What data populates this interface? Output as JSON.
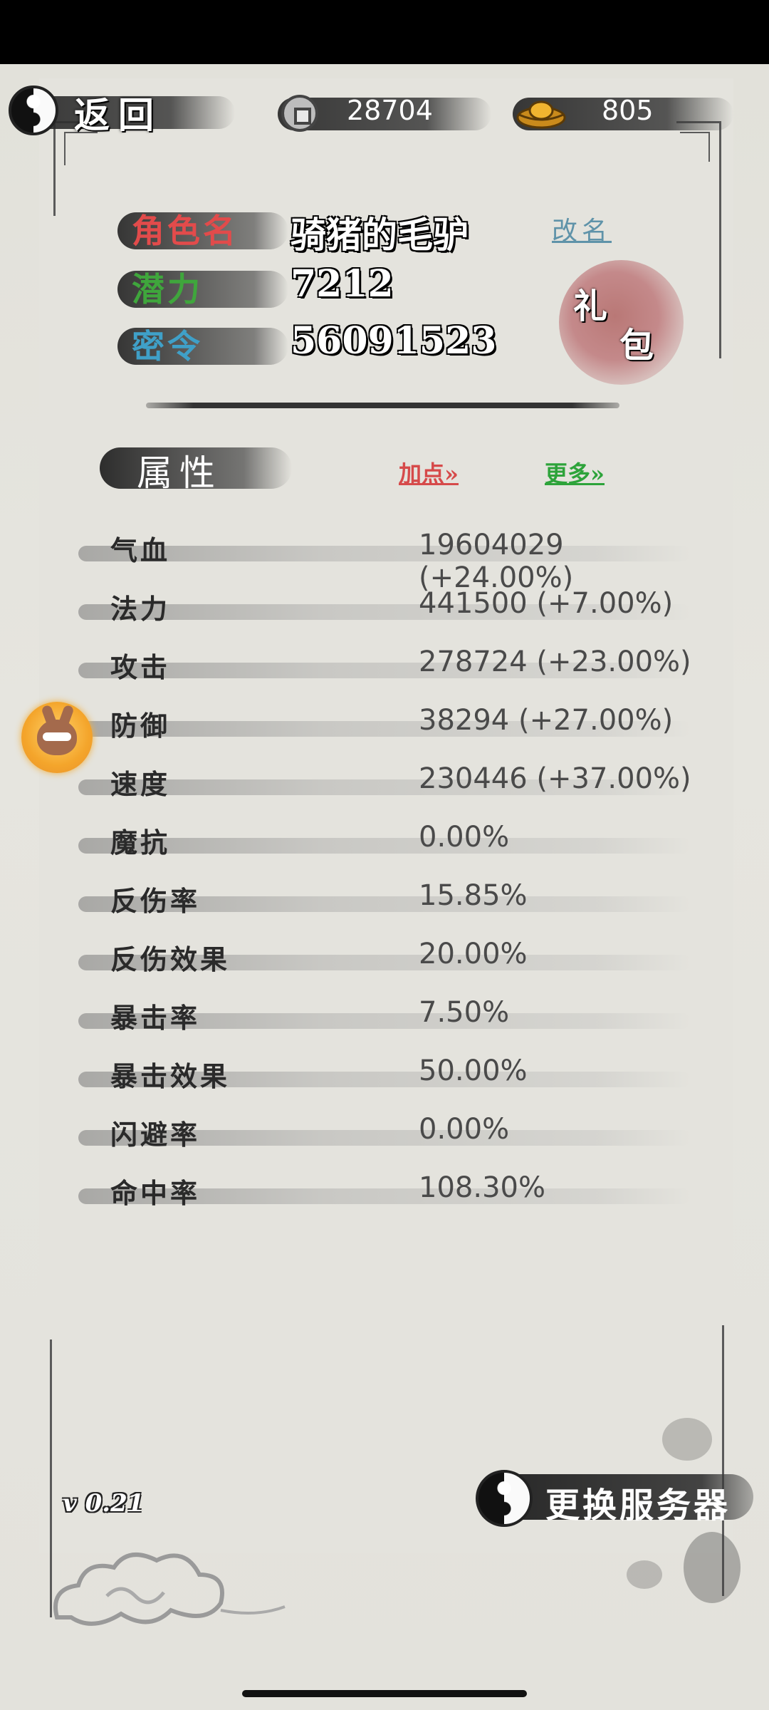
{
  "header": {
    "back_label": "返回",
    "coins": "28704",
    "gold": "805"
  },
  "profile": {
    "name_label": "角色名",
    "name_value": "骑猪的毛驴",
    "rename_label": "改名",
    "potential_label": "潜力",
    "potential_value": "7212",
    "password_label": "密令",
    "password_value": "56091523",
    "gift_label_1": "礼",
    "gift_label_2": "包"
  },
  "attributes": {
    "title": "属性",
    "add_points_label": "加点»",
    "more_label": "更多»",
    "rows": [
      {
        "name": "气血",
        "value": "19604029 (+24.00%)"
      },
      {
        "name": "法力",
        "value": "441500 (+7.00%)"
      },
      {
        "name": "攻击",
        "value": "278724 (+23.00%)"
      },
      {
        "name": "防御",
        "value": "38294 (+27.00%)"
      },
      {
        "name": "速度",
        "value": "230446 (+37.00%)"
      },
      {
        "name": "魔抗",
        "value": "0.00%"
      },
      {
        "name": "反伤率",
        "value": "15.85%"
      },
      {
        "name": "反伤效果",
        "value": "20.00%"
      },
      {
        "name": "暴击率",
        "value": "7.50%"
      },
      {
        "name": "暴击效果",
        "value": "50.00%"
      },
      {
        "name": "闪避率",
        "value": "0.00%"
      },
      {
        "name": "命中率",
        "value": "108.30%"
      }
    ]
  },
  "footer": {
    "version": "v 0.21",
    "change_server_label": "更换服务器"
  },
  "colors": {
    "name_label": "#e24b4b",
    "potential_label": "#3fa63c",
    "password_label": "#3fa0c8",
    "rename_link": "#5f93a9",
    "add_points": "#d64a4a",
    "more": "#2da33a"
  }
}
